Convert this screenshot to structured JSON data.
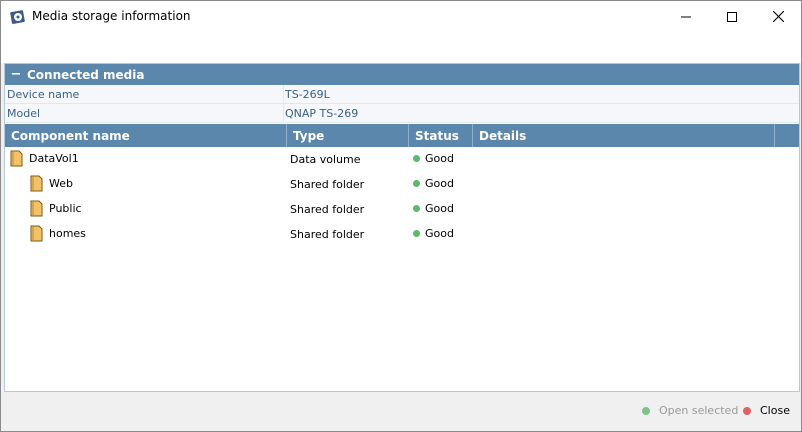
{
  "window": {
    "title": "Media storage information"
  },
  "section": {
    "collapse_sign": "−",
    "title": "Connected media"
  },
  "properties": [
    {
      "label": "Device name",
      "value": "TS-269L"
    },
    {
      "label": "Model",
      "value": "QNAP TS-269"
    }
  ],
  "grid": {
    "columns": [
      "Component name",
      "Type",
      "Status",
      "Details",
      ""
    ],
    "rows": [
      {
        "name": "DataVol1",
        "type": "Data volume",
        "status": "Good",
        "details": "",
        "level": 0
      },
      {
        "name": "Web",
        "type": "Shared folder",
        "status": "Good",
        "details": "",
        "level": 1
      },
      {
        "name": "Public",
        "type": "Shared folder",
        "status": "Good",
        "details": "",
        "level": 1
      },
      {
        "name": "homes",
        "type": "Shared folder",
        "status": "Good",
        "details": "",
        "level": 1
      }
    ]
  },
  "footer": {
    "open_selected": "Open selected",
    "close": "Close"
  },
  "colors": {
    "header_blue": "#5b87ad",
    "status_good": "#5cb86a",
    "folder": "#f3c267",
    "close_dot": "#e06262"
  }
}
